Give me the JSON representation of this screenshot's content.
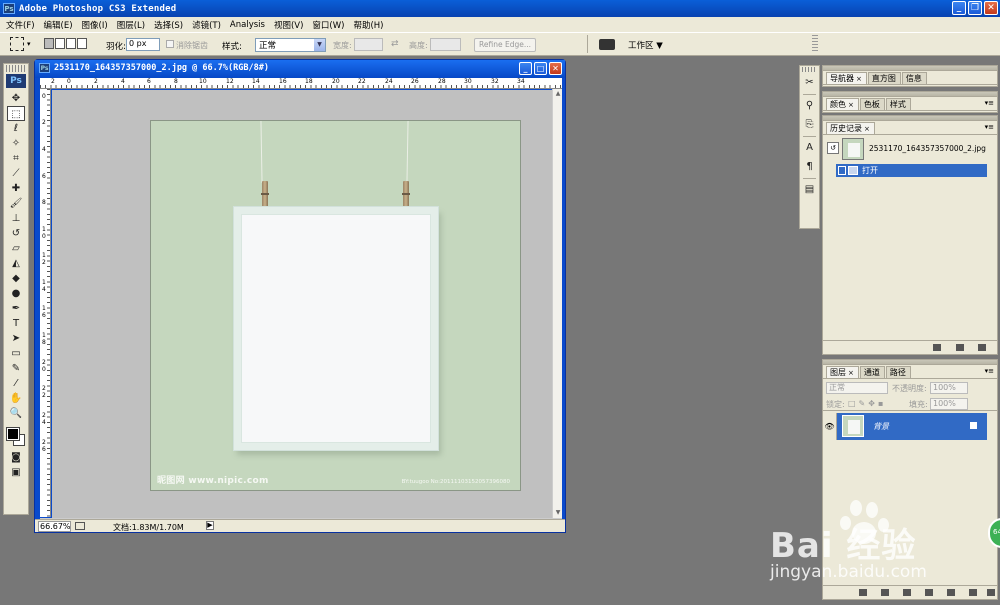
{
  "app": {
    "title": "Adobe Photoshop CS3 Extended",
    "logo": "Ps"
  },
  "menu": [
    "文件(F)",
    "编辑(E)",
    "图像(I)",
    "图层(L)",
    "选择(S)",
    "滤镜(T)",
    "Analysis",
    "视图(V)",
    "窗口(W)",
    "帮助(H)"
  ],
  "options": {
    "feather_label": "羽化:",
    "feather_value": "0 px",
    "antialias_label": "消除锯齿",
    "style_label": "样式:",
    "style_value": "正常",
    "width_label": "宽度:",
    "height_label": "高度:",
    "refine_edge": "Refine Edge...",
    "workspace": "工作区 ▼"
  },
  "document": {
    "title": "2531170_164357357000_2.jpg @ 66.7%(RGB/8#)",
    "zoom": "66.67%",
    "doc_info": "文档:1.83M/1.70M",
    "ruler_top": [
      "2",
      "0",
      "2",
      "4",
      "6",
      "8",
      "10",
      "12",
      "14",
      "16",
      "18",
      "20",
      "22",
      "24",
      "26",
      "28",
      "30",
      "32",
      "34"
    ],
    "ruler_left": [
      "0",
      "2",
      "4",
      "6",
      "8",
      "1 0",
      "1 2",
      "1 4",
      "1 6",
      "1 8",
      "2 0",
      "2 2",
      "2 4",
      "2 6"
    ]
  },
  "image": {
    "watermark_left": "昵图网 www.nipic.com",
    "watermark_right": "BY:tuugoo No:20111103152057396080"
  },
  "panels": {
    "navigator_tabs": [
      "导航器",
      "直方图",
      "信息"
    ],
    "color_tabs": [
      "颜色",
      "色板",
      "样式"
    ],
    "history_tab": "历史记录",
    "history_snapshot": "2531170_164357357000_2.jpg",
    "history_step": "打开",
    "layers_tabs": [
      "图层",
      "通道",
      "路径"
    ],
    "blend_mode": "正常",
    "opacity_label": "不透明度:",
    "opacity_value": "100%",
    "lock_label": "锁定:",
    "fill_label": "填充:",
    "fill_value": "100%",
    "layer_name": "背景"
  },
  "watermark": {
    "brand": "Bai 经验",
    "url": "jingyan.baidu.com",
    "badge": "64"
  }
}
